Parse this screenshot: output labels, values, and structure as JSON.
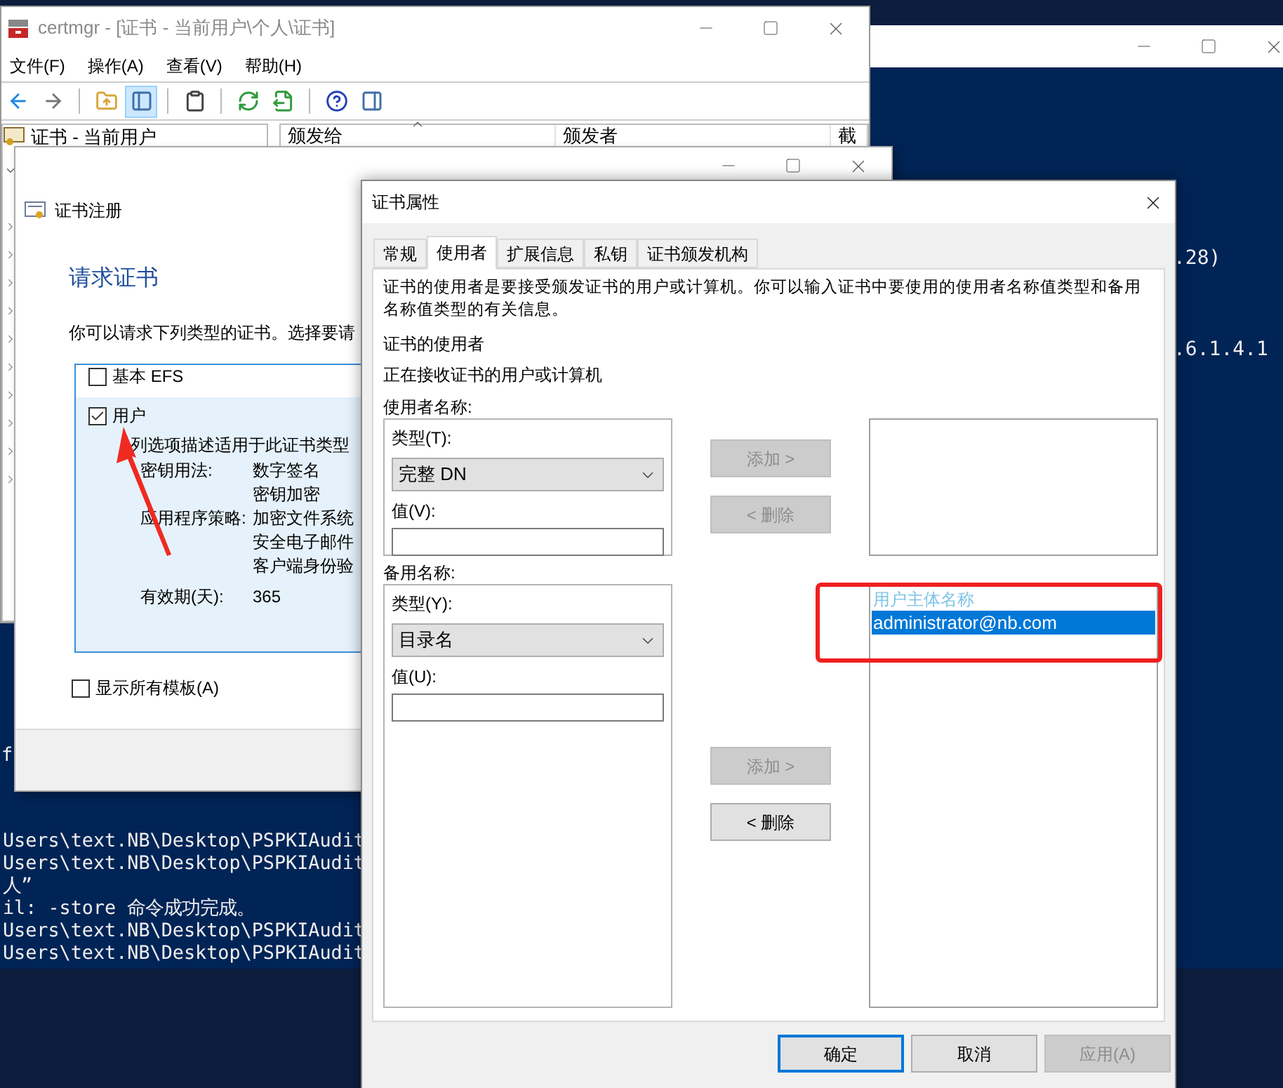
{
  "console": {
    "fragment": "f",
    "left_lines": [
      "Users\\text.NB\\Desktop\\PSPKIAudit",
      "Users\\text.NB\\Desktop\\PSPKIAudit",
      "人”",
      "il: -store 命令成功完成。",
      "Users\\text.NB\\Desktop\\PSPKIAudit",
      "Users\\text.NB\\Desktop\\PSPKIAudit"
    ],
    "right_lines": [
      ".28)",
      ".6.1.4.1"
    ]
  },
  "certmgr": {
    "title": "certmgr - [证书 - 当前用户\\个人\\证书]",
    "menu": [
      "文件(F)",
      "操作(A)",
      "查看(V)",
      "帮助(H)"
    ],
    "toolbar": [
      {
        "pressed": false
      },
      {
        "pressed": false
      },
      {
        "pressed": false
      },
      {
        "pressed": true
      },
      {
        "pressed": false
      },
      {
        "pressed": false
      },
      {
        "pressed": false
      },
      {
        "pressed": false
      },
      {
        "pressed": false
      }
    ],
    "tree": {
      "label": "证书 - 当前用户",
      "children": [
        {
          "expanded": true
        },
        {
          "expanded": false
        },
        {
          "expanded": false
        },
        {
          "expanded": false
        },
        {
          "expanded": false
        },
        {
          "expanded": false
        },
        {
          "expanded": false
        },
        {
          "expanded": false
        },
        {
          "expanded": false
        },
        {
          "expanded": false
        },
        {
          "expanded": false
        }
      ]
    },
    "columns": [
      "颁发给",
      "颁发者",
      "截"
    ]
  },
  "enrollment": {
    "title": "证书注册",
    "heading": "请求证书",
    "intro": "你可以请求下列类型的证书。选择要请",
    "templates": [
      {
        "label": "基本 EFS",
        "checked": false,
        "selected": false
      },
      {
        "label": "用户",
        "checked": true,
        "selected": true,
        "description": "列选项描述适用于此证书类型",
        "details": [
          {
            "label": "密钥用法:",
            "values": [
              "数字签名",
              "密钥加密"
            ]
          },
          {
            "label": "应用程序策略:",
            "values": [
              "加密文件系统",
              "安全电子邮件",
              "客户端身份验"
            ]
          },
          {
            "label": "有效期(天):",
            "values": [
              "365"
            ]
          }
        ]
      }
    ],
    "show_all": {
      "label": "显示所有模板(A)",
      "checked": false
    }
  },
  "dialog": {
    "title": "证书属性",
    "tabs": [
      {
        "label": "常规",
        "selected": false
      },
      {
        "label": "使用者",
        "selected": true
      },
      {
        "label": "扩展信息",
        "selected": false
      },
      {
        "label": "私钥",
        "selected": false
      },
      {
        "label": "证书颁发机构",
        "selected": false
      }
    ],
    "description": "证书的使用者是要接受颁发证书的用户或计算机。你可以输入证书中要使用的使用者名称值类型和备用名称值类型的有关信息。",
    "subject_heading": "证书的使用者",
    "subject_note": "正在接收证书的用户或计算机",
    "sections": [
      {
        "label": "使用者名称:",
        "type_label": "类型(T):",
        "type_value": "完整 DN",
        "value_label": "值(V):",
        "buttons": [
          {
            "label": "添加 >",
            "disabled": true
          },
          {
            "label": "< 删除",
            "disabled": true
          }
        ]
      },
      {
        "label": "备用名称:",
        "type_label": "类型(Y):",
        "type_value": "目录名",
        "value_label": "值(U):",
        "buttons": [
          {
            "label": "添加 >",
            "disabled": true
          },
          {
            "label": "< 删除",
            "disabled": false
          }
        ],
        "list": [
          {
            "kind": "group",
            "label": "用户主体名称"
          },
          {
            "kind": "item",
            "label": "administrator@nb.com",
            "selected": true
          }
        ]
      }
    ],
    "buttons": [
      {
        "label": "确定",
        "default": true,
        "disabled": false
      },
      {
        "label": "取消",
        "default": false,
        "disabled": false
      },
      {
        "label": "应用(A)",
        "default": false,
        "disabled": true
      }
    ]
  }
}
